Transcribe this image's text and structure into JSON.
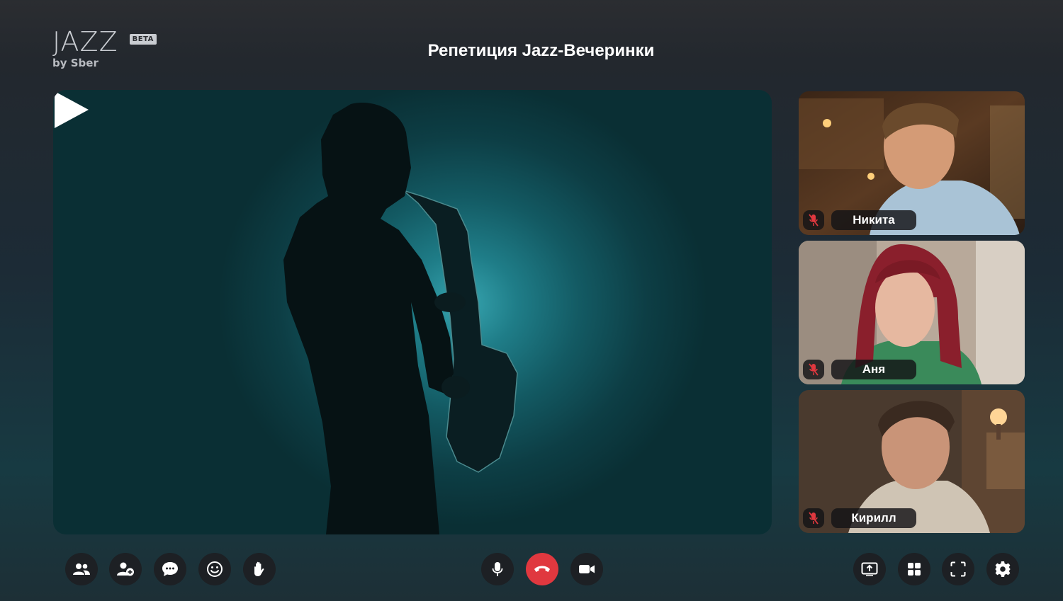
{
  "app": {
    "logo_text": "JAZZ",
    "logo_badge": "BETA",
    "logo_sub": "by Sber"
  },
  "meeting": {
    "title": "Репетиция Jazz-Вечеринки"
  },
  "main_video": {
    "play_icon": "play-icon"
  },
  "participants": [
    {
      "name": "Никита",
      "muted": true
    },
    {
      "name": "Аня",
      "muted": true
    },
    {
      "name": "Кирилл",
      "muted": true
    }
  ],
  "toolbar": {
    "left": [
      "participants-icon",
      "add-participant-icon",
      "chat-icon",
      "emoji-icon",
      "raise-hand-icon"
    ],
    "center": [
      "microphone-icon",
      "end-call-icon",
      "camera-icon"
    ],
    "right": [
      "share-screen-icon",
      "layout-grid-icon",
      "fullscreen-icon",
      "settings-icon"
    ]
  },
  "colors": {
    "end_call": "#e0383f",
    "button_bg": "#1d2024",
    "mute_icon": "#e0383f"
  }
}
